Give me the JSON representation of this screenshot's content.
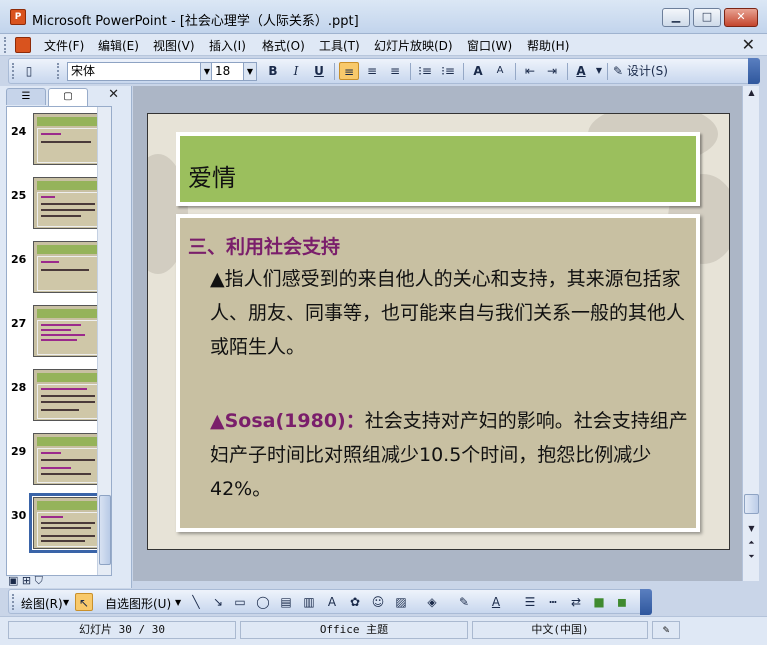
{
  "window": {
    "title": "Microsoft PowerPoint - [社会心理学（人际关系）.ppt]",
    "app_icon": "powerpoint-icon"
  },
  "menu": {
    "items": [
      "文件(F)",
      "编辑(E)",
      "视图(V)",
      "插入(I)",
      "格式(O)",
      "工具(T)",
      "幻灯片放映(D)",
      "窗口(W)",
      "帮助(H)"
    ]
  },
  "toolbar": {
    "font_name": "宋体",
    "font_size": "18",
    "bold": "B",
    "italic": "I",
    "underline": "U",
    "grow_font": "A",
    "shrink_font": "A",
    "font_color": "A",
    "design_label": "设计(S)"
  },
  "pane": {
    "close": "✕"
  },
  "thumbnails": [
    {
      "number": "24"
    },
    {
      "number": "25"
    },
    {
      "number": "26"
    },
    {
      "number": "27"
    },
    {
      "number": "28"
    },
    {
      "number": "29"
    },
    {
      "number": "30",
      "selected": true
    }
  ],
  "slide": {
    "title": "爱情",
    "heading": "三、利用社会支持",
    "paragraph1": "▲指人们感受到的来自他人的关心和支持，其来源包括家人、朋友、同事等，也可能来自与我们关系一般的其他人或陌生人。",
    "para2_prefix": "▲Sosa(1980)：",
    "para2_text": "社会支持对产妇的影响。社会支持组产妇产子时间比对照组减少10.5个时间，抱怨比例减少42%。"
  },
  "drawing_toolbar": {
    "draw_label": "绘图(R)",
    "autoshape_label": "自选图形(U)"
  },
  "status": {
    "slide_info": "幻灯片 30 / 30",
    "theme": "Office 主题",
    "language": "中文(中国)"
  },
  "colors": {
    "title_bg": "#9bbf5d",
    "body_bg": "#c8c0a2",
    "heading_color": "#7a1e6b"
  }
}
